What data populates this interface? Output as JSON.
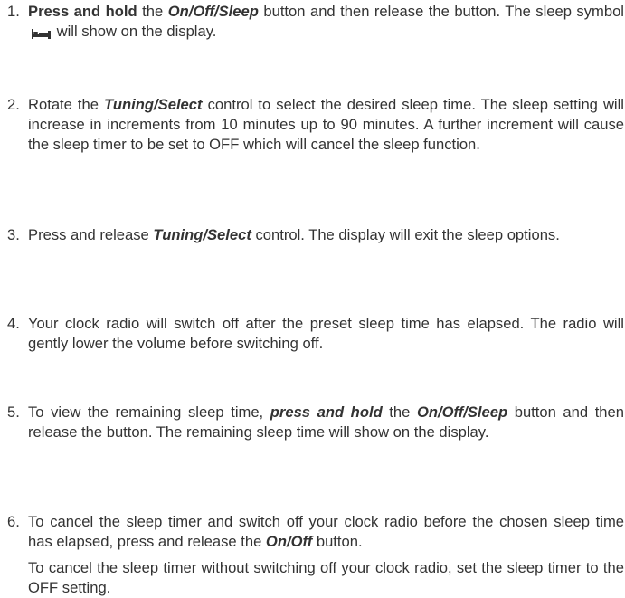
{
  "steps": [
    {
      "number": "1.",
      "paragraphs": [
        [
          {
            "text": "Press and hold",
            "style": "b"
          },
          {
            "text": " the "
          },
          {
            "text": "On/Off/Sleep",
            "style": "bi"
          },
          {
            "text": " button and then release the button. The sleep symbol "
          },
          {
            "icon": "sleep-icon"
          },
          {
            "text": " will show on the display."
          }
        ]
      ]
    },
    {
      "number": "2.",
      "paragraphs": [
        [
          {
            "text": "Rotate the "
          },
          {
            "text": "Tuning/Select",
            "style": "bi"
          },
          {
            "text": " control to select the desired sleep time. The sleep setting will increase in increments from 10 minutes up to 90 minutes. A further increment will cause the sleep timer to be set to OFF which will cancel the sleep function."
          }
        ]
      ]
    },
    {
      "number": "3.",
      "paragraphs": [
        [
          {
            "text": "Press and release "
          },
          {
            "text": "Tuning/Select",
            "style": "bi"
          },
          {
            "text": " control. The display will exit the sleep options."
          }
        ]
      ]
    },
    {
      "number": "4.",
      "paragraphs": [
        [
          {
            "text": "Your clock radio will switch off after the preset sleep time has elapsed. The radio will gently lower the volume before switching off."
          }
        ]
      ]
    },
    {
      "number": "5.",
      "paragraphs": [
        [
          {
            "text": "To view the remaining sleep time, "
          },
          {
            "text": "press and hold",
            "style": "bi"
          },
          {
            "text": " the "
          },
          {
            "text": "On/Off/Sleep",
            "style": "bi"
          },
          {
            "text": " button and then release the button. The remaining sleep time will show on the display."
          }
        ]
      ]
    },
    {
      "number": "6.",
      "paragraphs": [
        [
          {
            "text": "To cancel the sleep timer and switch off your clock radio before the chosen sleep time has elapsed, press and release the "
          },
          {
            "text": "On/Off",
            "style": "bi"
          },
          {
            "text": " button."
          }
        ],
        [
          {
            "text": "To cancel the sleep timer without switching off your clock radio, set the sleep timer to the OFF setting."
          }
        ]
      ]
    }
  ]
}
